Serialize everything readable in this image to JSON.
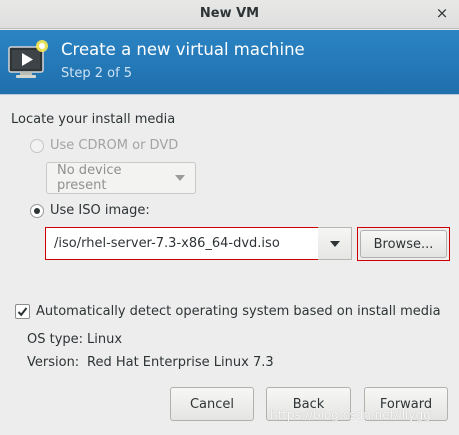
{
  "window": {
    "title": "New VM",
    "close_glyph": "×"
  },
  "banner": {
    "title": "Create a new virtual machine",
    "step": "Step 2 of 5",
    "icon": "vm-monitor-icon"
  },
  "media": {
    "section_label": "Locate your install media",
    "cdrom_label": "Use CDROM or DVD",
    "cdrom_device": "No device present",
    "iso_label": "Use ISO image:",
    "iso_path": "/iso/rhel-server-7.3-x86_64-dvd.iso",
    "browse_label": "Browse..."
  },
  "detect": {
    "label": "Automatically detect operating system based on install media",
    "checked": true
  },
  "os": {
    "type_label": "OS type:",
    "type_value": "Linux",
    "version_label": "Version:",
    "version_value": "Red Hat Enterprise Linux 7.3"
  },
  "buttons": {
    "cancel": "Cancel",
    "back": "Back",
    "forward": "Forward"
  },
  "watermark": "https://blog.csdn.net/lllygg",
  "colors": {
    "banner": "#1f73b3",
    "highlight_border": "#cc0000"
  }
}
